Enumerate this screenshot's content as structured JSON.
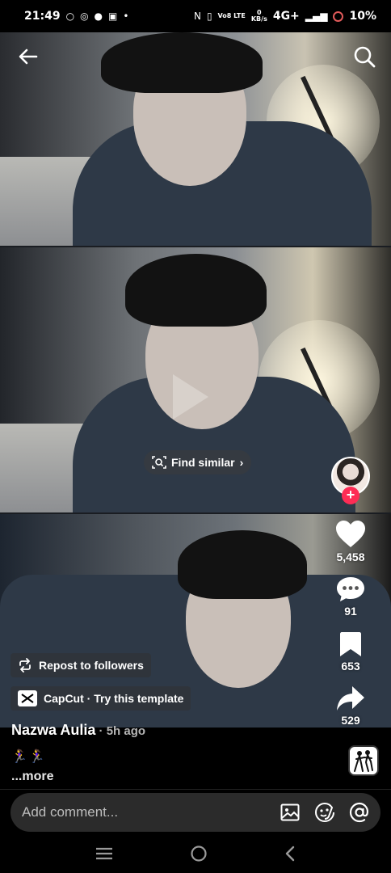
{
  "status_bar": {
    "time": "21:49",
    "network": "4G+",
    "volte_label": "Vo8 LTE",
    "speed_value": "0",
    "speed_unit": "KB/s",
    "battery": "10%"
  },
  "video": {
    "find_similar_label": "Find similar"
  },
  "sidebar": {
    "like_count": "5,458",
    "comment_count": "91",
    "save_count": "653",
    "share_count": "529"
  },
  "chips": {
    "repost_label": "Repost to followers",
    "capcut_label": "CapCut · Try this template"
  },
  "caption": {
    "author": "Nazwa Aulia",
    "time": " · 5h ago",
    "emoji": "🏃‍♀️🏃‍♀️",
    "more_label": "...more"
  },
  "comment_bar": {
    "placeholder": "Add comment..."
  },
  "colors": {
    "accent": "#fe2c55",
    "background": "#000000",
    "comment_bar": "#2b2b2b"
  },
  "icons": [
    "back-arrow-icon",
    "search-icon",
    "heart-icon",
    "comment-bubble-icon",
    "bookmark-icon",
    "share-arrow-icon",
    "repost-icon",
    "capcut-icon",
    "image-icon",
    "emoji-icon",
    "mention-icon",
    "recents-icon",
    "home-icon",
    "back-nav-icon"
  ]
}
